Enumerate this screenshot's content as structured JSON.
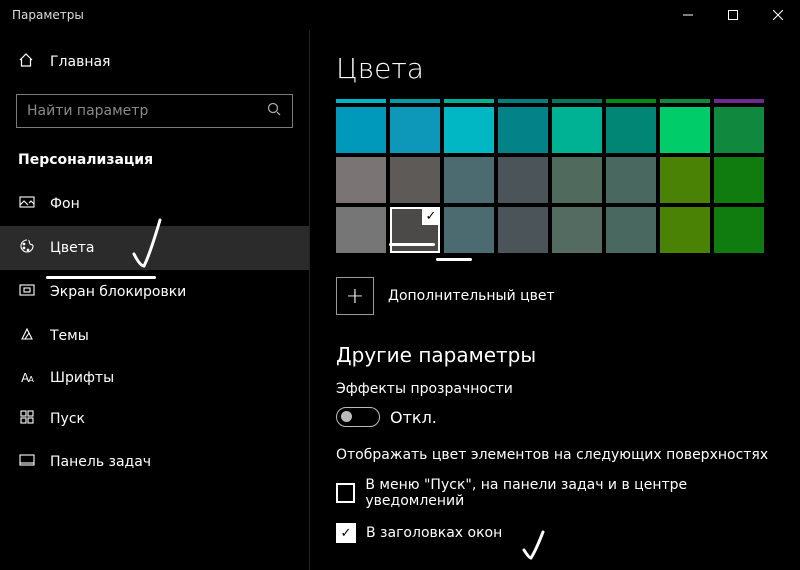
{
  "window_title": "Параметры",
  "home_label": "Главная",
  "search_placeholder": "Найти параметр",
  "section_label": "Персонализация",
  "nav": {
    "background": "Фон",
    "colors": "Цвета",
    "lockscreen": "Экран блокировки",
    "themes": "Темы",
    "fonts": "Шрифты",
    "start": "Пуск",
    "taskbar": "Панель задач"
  },
  "page_title": "Цвета",
  "add_color_label": "Дополнительный цвет",
  "more_params_title": "Другие параметры",
  "transparency_label": "Эффекты прозрачности",
  "toggle_off": "Откл.",
  "surface_label": "Отображать цвет элементов на следующих поверхностях",
  "cb_start_label": "В меню \"Пуск\", на панели задач и в центре уведомлений",
  "cb_titlebars_label": "В заголовках окон",
  "palette_top_strip": [
    "#00b7c3",
    "#009ca6",
    "#00b294",
    "#007e7a",
    "#007a5a",
    "#008a17",
    "#10893e",
    "#6b2c91"
  ],
  "palette_rows": [
    [
      "#0099bc",
      "#0d98ba",
      "#00b7c3",
      "#038387",
      "#00b294",
      "#018574",
      "#00cc6a",
      "#10893e"
    ],
    [
      "#7a7574",
      "#5d5a58",
      "#4c6b70",
      "#4a5459",
      "#506b5d",
      "#486860",
      "#498205",
      "#107c10"
    ],
    [
      "#767676",
      "#4c4a48",
      "#4c6b70",
      "#4a5459",
      "#536b61",
      "#486860",
      "#498205",
      "#107c10"
    ]
  ],
  "selected_swatch": {
    "row": 2,
    "col": 1
  }
}
